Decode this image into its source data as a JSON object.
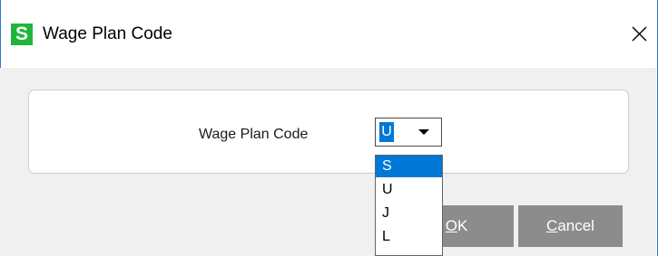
{
  "window": {
    "title": "Wage Plan Code",
    "app_icon_letter": "S",
    "close_glyph": "close-icon"
  },
  "form": {
    "field_label": "Wage Plan Code",
    "selected_value": "U"
  },
  "dropdown": {
    "options": [
      "S",
      "U",
      "J",
      "L"
    ],
    "highlighted": "S"
  },
  "buttons": {
    "ok_underlined": "O",
    "ok_rest": "K",
    "cancel_underlined": "C",
    "cancel_rest": "ancel"
  },
  "colors": {
    "accent": "#0078d7",
    "app_icon": "#1fb53a",
    "button_bg": "#8c8c8c"
  }
}
